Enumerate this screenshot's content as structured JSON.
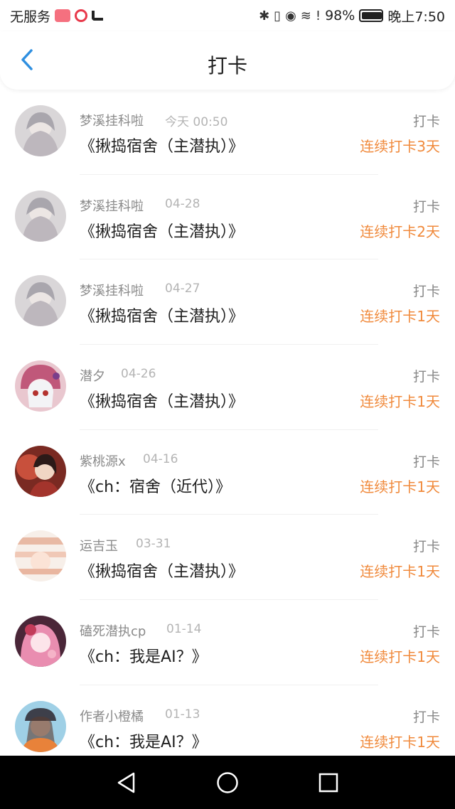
{
  "status_bar": {
    "carrier": "无服务",
    "battery": "98%",
    "time": "晚上7:50"
  },
  "header": {
    "title": "打卡"
  },
  "entries": [
    {
      "user": "梦溪挂科啦",
      "date": "今天 00:50",
      "book": "《揪捣宿舍（主潜执）》",
      "kind": "打卡",
      "streak": "连续打卡3天"
    },
    {
      "user": "梦溪挂科啦",
      "date": "04-28",
      "book": "《揪捣宿舍（主潜执）》",
      "kind": "打卡",
      "streak": "连续打卡2天"
    },
    {
      "user": "梦溪挂科啦",
      "date": "04-27",
      "book": "《揪捣宿舍（主潜执）》",
      "kind": "打卡",
      "streak": "连续打卡1天"
    },
    {
      "user": "潜夕",
      "date": "04-26",
      "book": "《揪捣宿舍（主潜执）》",
      "kind": "打卡",
      "streak": "连续打卡1天"
    },
    {
      "user": "紫桃源x",
      "date": "04-16",
      "book": "《ch：宿舍（近代）》",
      "kind": "打卡",
      "streak": "连续打卡1天"
    },
    {
      "user": "运吉玉",
      "date": "03-31",
      "book": "《揪捣宿舍（主潜执）》",
      "kind": "打卡",
      "streak": "连续打卡1天"
    },
    {
      "user": "磕死潜执cp",
      "date": "01-14",
      "book": "《ch：我是AI？》",
      "kind": "打卡",
      "streak": "连续打卡1天"
    },
    {
      "user": "作者小橙橘",
      "date": "01-13",
      "book": "《ch：我是AI？》",
      "kind": "打卡",
      "streak": "连续打卡1天"
    }
  ],
  "colors": {
    "accent_back": "#2f8fe0",
    "streak": "#f08a3c"
  }
}
